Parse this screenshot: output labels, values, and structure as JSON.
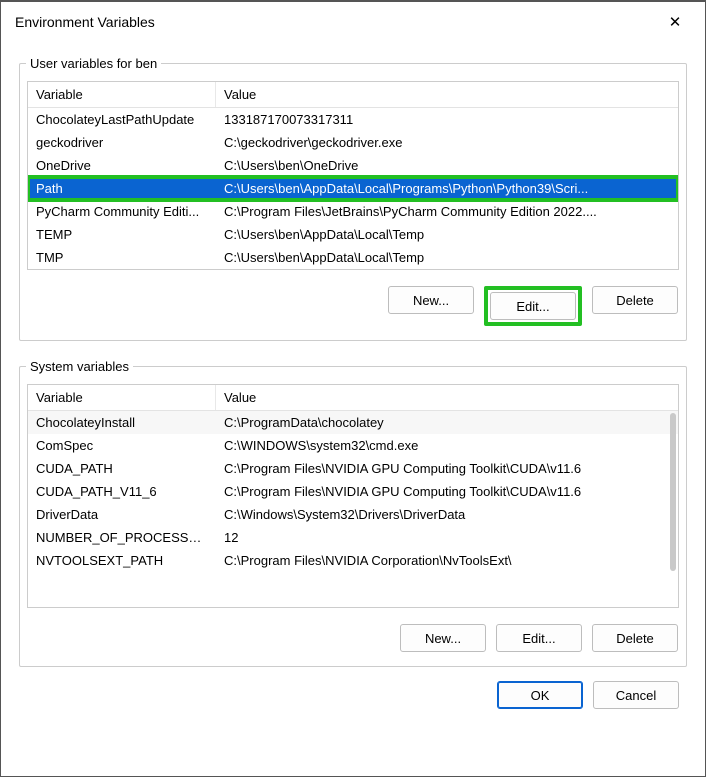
{
  "window": {
    "title": "Environment Variables",
    "close_glyph": "✕"
  },
  "user_section": {
    "legend": "User variables for ben",
    "columns": {
      "variable": "Variable",
      "value": "Value"
    },
    "rows": [
      {
        "name": "ChocolateyLastPathUpdate",
        "value": "133187170073317311"
      },
      {
        "name": "geckodriver",
        "value": "C:\\geckodriver\\geckodriver.exe"
      },
      {
        "name": "OneDrive",
        "value": "C:\\Users\\ben\\OneDrive"
      },
      {
        "name": "Path",
        "value": "C:\\Users\\ben\\AppData\\Local\\Programs\\Python\\Python39\\Scri..."
      },
      {
        "name": "PyCharm Community Editi...",
        "value": "C:\\Program Files\\JetBrains\\PyCharm Community Edition 2022...."
      },
      {
        "name": "TEMP",
        "value": "C:\\Users\\ben\\AppData\\Local\\Temp"
      },
      {
        "name": "TMP",
        "value": "C:\\Users\\ben\\AppData\\Local\\Temp"
      }
    ],
    "selected_index": 3,
    "buttons": {
      "new": "New...",
      "edit": "Edit...",
      "delete": "Delete"
    }
  },
  "system_section": {
    "legend": "System variables",
    "columns": {
      "variable": "Variable",
      "value": "Value"
    },
    "rows": [
      {
        "name": "ChocolateyInstall",
        "value": "C:\\ProgramData\\chocolatey"
      },
      {
        "name": "ComSpec",
        "value": "C:\\WINDOWS\\system32\\cmd.exe"
      },
      {
        "name": "CUDA_PATH",
        "value": "C:\\Program Files\\NVIDIA GPU Computing Toolkit\\CUDA\\v11.6"
      },
      {
        "name": "CUDA_PATH_V11_6",
        "value": "C:\\Program Files\\NVIDIA GPU Computing Toolkit\\CUDA\\v11.6"
      },
      {
        "name": "DriverData",
        "value": "C:\\Windows\\System32\\Drivers\\DriverData"
      },
      {
        "name": "NUMBER_OF_PROCESSORS",
        "value": "12"
      },
      {
        "name": "NVTOOLSEXT_PATH",
        "value": "C:\\Program Files\\NVIDIA Corporation\\NvToolsExt\\"
      }
    ],
    "buttons": {
      "new": "New...",
      "edit": "Edit...",
      "delete": "Delete"
    }
  },
  "dialog_buttons": {
    "ok": "OK",
    "cancel": "Cancel"
  },
  "highlight": {
    "selected_row": true,
    "edit_button": true
  }
}
